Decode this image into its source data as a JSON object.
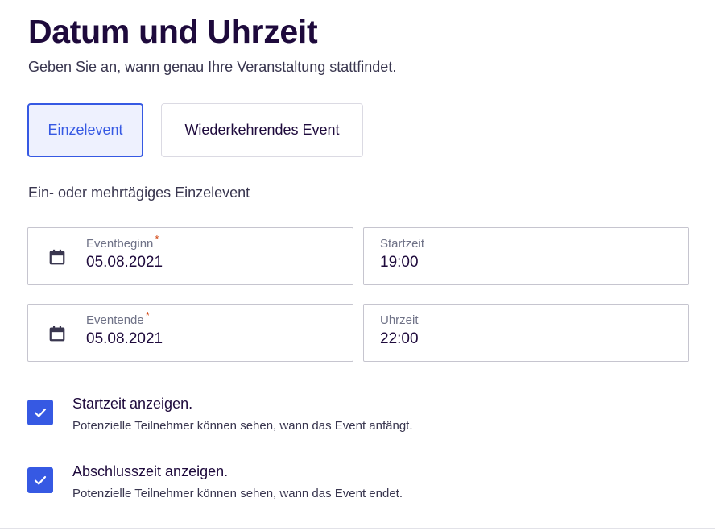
{
  "header": {
    "title": "Datum und Uhrzeit",
    "subtitle": "Geben Sie an, wann genau Ihre Veranstaltung stattfindet."
  },
  "event_type": {
    "options": [
      {
        "label": "Einzelevent",
        "selected": true
      },
      {
        "label": "Wiederkehrendes Event",
        "selected": false
      }
    ]
  },
  "section": {
    "label": "Ein- oder mehrtägiges Einzelevent"
  },
  "fields": {
    "start_date": {
      "label": "Eventbeginn",
      "required_mark": "*",
      "value": "05.08.2021",
      "icon": "calendar-icon"
    },
    "start_time": {
      "label": "Startzeit",
      "value": "19:00"
    },
    "end_date": {
      "label": "Eventende",
      "required_mark": "*",
      "value": "05.08.2021",
      "icon": "calendar-icon"
    },
    "end_time": {
      "label": "Uhrzeit",
      "value": "22:00"
    }
  },
  "checkboxes": [
    {
      "title": "Startzeit anzeigen.",
      "description": "Potenzielle Teilnehmer können sehen, wann das Event anfängt.",
      "checked": true
    },
    {
      "title": "Abschlusszeit anzeigen.",
      "description": "Potenzielle Teilnehmer können sehen, wann das Event endet.",
      "checked": true
    }
  ],
  "colors": {
    "accent": "#3659e3",
    "accent_bg": "#eef1fe",
    "heading": "#1e0a3c",
    "required": "#d1410c"
  }
}
